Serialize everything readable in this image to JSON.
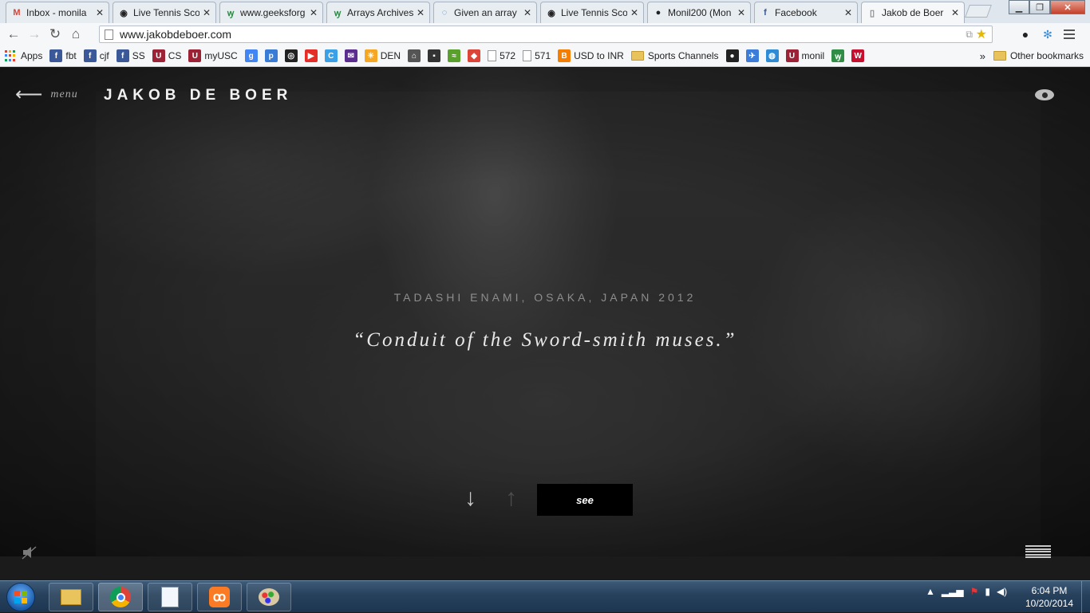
{
  "browser": {
    "tabs": [
      {
        "label": "Inbox - monila",
        "icon": "gmail-icon",
        "color": "#d44638",
        "glyph": "M"
      },
      {
        "label": "Live Tennis Scor",
        "icon": "tennis-icon",
        "color": "#222222",
        "glyph": "◉"
      },
      {
        "label": "www.geeksforg",
        "icon": "geeks-icon",
        "color": "#2f8d46",
        "glyph": "ꝡ"
      },
      {
        "label": "Arrays Archives",
        "icon": "geeks-icon",
        "color": "#2f8d46",
        "glyph": "ꝡ"
      },
      {
        "label": "Given an array",
        "icon": "leetcode-icon",
        "color": "#2a7bd3",
        "glyph": "◌"
      },
      {
        "label": "Live Tennis Scor",
        "icon": "tennis-icon",
        "color": "#222222",
        "glyph": "◉"
      },
      {
        "label": "Monil200 (Mon",
        "icon": "github-icon",
        "color": "#222222",
        "glyph": "●"
      },
      {
        "label": "Facebook",
        "icon": "facebook-icon",
        "color": "#3b5998",
        "glyph": "f"
      },
      {
        "label": "Jakob de Boer",
        "icon": "page-icon",
        "color": "#888888",
        "glyph": "▯"
      }
    ],
    "url": "www.jakobdeboer.com"
  },
  "bookmarks": {
    "items": [
      {
        "label": "Apps",
        "icon": "apps-icon"
      },
      {
        "label": "fbt",
        "icon": "facebook-icon",
        "color": "#3b5998",
        "glyph": "f"
      },
      {
        "label": "cjf",
        "icon": "facebook-icon",
        "color": "#3b5998",
        "glyph": "f"
      },
      {
        "label": "SS",
        "icon": "facebook-icon",
        "color": "#3b5998",
        "glyph": "f"
      },
      {
        "label": "CS",
        "icon": "usc-icon",
        "color": "#9d2235",
        "glyph": "U"
      },
      {
        "label": "myUSC",
        "icon": "usc-icon",
        "color": "#9d2235",
        "glyph": "U"
      },
      {
        "label": "",
        "icon": "google-icon",
        "color": "#4285f4",
        "glyph": "g"
      },
      {
        "label": "",
        "icon": "p-icon",
        "color": "#3a7bd5",
        "glyph": "p"
      },
      {
        "label": "",
        "icon": "camera-icon",
        "color": "#222222",
        "glyph": "◎"
      },
      {
        "label": "",
        "icon": "youtube-icon",
        "color": "#e52d27",
        "glyph": "▶"
      },
      {
        "label": "",
        "icon": "c-icon",
        "color": "#3aa0e8",
        "glyph": "C"
      },
      {
        "label": "",
        "icon": "yahoo-mail-icon",
        "color": "#5c2d91",
        "glyph": "✉"
      },
      {
        "label": "DEN",
        "icon": "walmart-icon",
        "color": "#f5a623",
        "glyph": "✳"
      },
      {
        "label": "",
        "icon": "bank-icon",
        "color": "#555555",
        "glyph": "⌂"
      },
      {
        "label": "",
        "icon": "dark-icon",
        "color": "#333333",
        "glyph": "▪"
      },
      {
        "label": "",
        "icon": "green-icon",
        "color": "#5aa02c",
        "glyph": "≈"
      },
      {
        "label": "",
        "icon": "maps-icon",
        "color": "#db4437",
        "glyph": "◆"
      },
      {
        "label": "572",
        "icon": "page-icon",
        "color": "#bbbbbb",
        "glyph": ""
      },
      {
        "label": "571",
        "icon": "page-icon",
        "color": "#bbbbbb",
        "glyph": ""
      },
      {
        "label": "USD to INR",
        "icon": "blogger-icon",
        "color": "#f57d00",
        "glyph": "B"
      },
      {
        "label": "Sports Channels",
        "icon": "folder-icon",
        "color": "#e8c25a",
        "glyph": ""
      },
      {
        "label": "",
        "icon": "github-icon",
        "color": "#222222",
        "glyph": "●"
      },
      {
        "label": "",
        "icon": "bird-icon",
        "color": "#3b7dd8",
        "glyph": "✈"
      },
      {
        "label": "",
        "icon": "att-icon",
        "color": "#2e8bd6",
        "glyph": "◍"
      },
      {
        "label": "monil",
        "icon": "usc-icon",
        "color": "#9d2235",
        "glyph": "U"
      },
      {
        "label": "",
        "icon": "geeks-icon",
        "color": "#2f8d46",
        "glyph": "ꝡ"
      },
      {
        "label": "",
        "icon": "wf-icon",
        "color": "#c8102e",
        "glyph": "W"
      }
    ],
    "overflow": "»",
    "other": "Other bookmarks"
  },
  "site": {
    "menu_label": "menu",
    "title": "JAKOB DE BOER",
    "caption": "TADASHI ENAMI, OSAKA, JAPAN 2012",
    "quote": "“Conduit of the Sword-smith muses.”",
    "see_label": "see"
  },
  "taskbar": {
    "time": "6:04 PM",
    "date": "10/20/2014"
  }
}
